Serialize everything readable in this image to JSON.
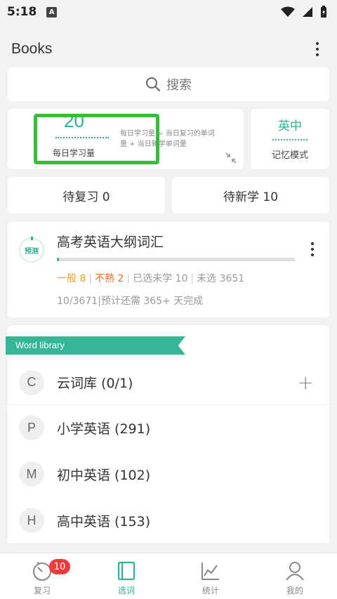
{
  "status_bar": {
    "time": "5:18",
    "notification": "A"
  },
  "app_bar": {
    "title": "Books"
  },
  "search": {
    "placeholder": "搜索"
  },
  "daily_plan": {
    "count": "20",
    "label": "每日学习量",
    "description": "每日学习量 = 当日复习的单词量 + 当日新学单词量"
  },
  "memory_mode": {
    "value": "英中",
    "label": "记忆模式"
  },
  "pending": {
    "review": "待复习 0",
    "new": "待新学 10"
  },
  "book": {
    "badge": "预测",
    "name": "高考英语大纲词汇",
    "progress": 0.003,
    "general": "一般 8",
    "unfamiliar": "不熟 2",
    "selected_unlearned": "已选未学 10",
    "unselected": "未选 3651",
    "count": "10/3671",
    "eta": "预计还需 365+ 天完成"
  },
  "library": {
    "ribbon": "Word library",
    "items": [
      {
        "letter": "C",
        "label": "云词库 (0/1)"
      },
      {
        "letter": "P",
        "label": "小学英语 (291)"
      },
      {
        "letter": "M",
        "label": "初中英语 (102)"
      },
      {
        "letter": "H",
        "label": "高中英语 (153)"
      }
    ]
  },
  "bottom_nav": {
    "items": [
      {
        "label": "复习",
        "badge": "10"
      },
      {
        "label": "选词"
      },
      {
        "label": "统计"
      },
      {
        "label": "我的"
      }
    ]
  },
  "colors": {
    "accent": "#2fae95",
    "highlight": "#3cba3c",
    "badge": "#f13a3a",
    "general": "#f0a020",
    "unfamiliar": "#ef6a2a"
  }
}
